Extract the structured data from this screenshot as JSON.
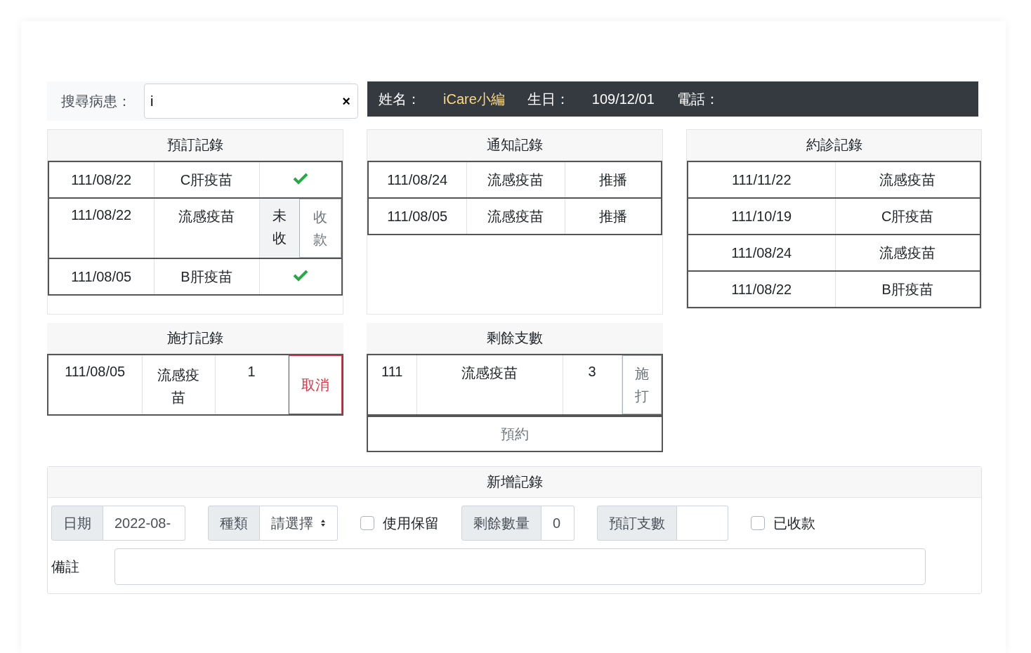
{
  "search": {
    "label": "搜尋病患：",
    "value": "i",
    "clear": "×"
  },
  "patient": {
    "name_label": "姓名：",
    "name": "iCare小編",
    "birthday_label": "生日：",
    "birthday": "109/12/01",
    "phone_label": "電話："
  },
  "bookings": {
    "title": "預訂記錄",
    "rows": [
      {
        "date": "111/08/22",
        "vaccine": "C肝疫苗",
        "paid": true
      },
      {
        "date": "111/08/22",
        "vaccine": "流感疫苗",
        "paid": false,
        "unpaid_text": "未收",
        "collect_button": "收款"
      },
      {
        "date": "111/08/05",
        "vaccine": "B肝疫苗",
        "paid": true
      }
    ]
  },
  "notifications": {
    "title": "通知記錄",
    "rows": [
      {
        "date": "111/08/24",
        "vaccine": "流感疫苗",
        "method": "推播"
      },
      {
        "date": "111/08/05",
        "vaccine": "流感疫苗",
        "method": "推播"
      }
    ]
  },
  "appointments": {
    "title": "約診記錄",
    "rows": [
      {
        "date": "111/11/22",
        "vaccine": "流感疫苗"
      },
      {
        "date": "111/10/19",
        "vaccine": "C肝疫苗"
      },
      {
        "date": "111/08/24",
        "vaccine": "流感疫苗"
      },
      {
        "date": "111/08/22",
        "vaccine": "B肝疫苗"
      }
    ]
  },
  "injections": {
    "title": "施打記錄",
    "rows": [
      {
        "date": "111/08/05",
        "vaccine": "流感疫苗",
        "count": "1",
        "cancel_button": "取消"
      }
    ]
  },
  "remaining": {
    "title": "剩餘支數",
    "rows": [
      {
        "year": "111",
        "vaccine": "流感疫苗",
        "count": "3",
        "inject_button": "施打"
      }
    ],
    "book_button": "預約"
  },
  "new_record": {
    "title": "新增記錄",
    "date": {
      "label": "日期",
      "value": "2022-08-"
    },
    "type": {
      "label": "種類",
      "placeholder": "請選擇"
    },
    "use_reserve": {
      "label": "使用保留",
      "checked": false
    },
    "remaining_qty": {
      "label": "剩餘數量",
      "value": "0"
    },
    "booking_qty": {
      "label": "預訂支數"
    },
    "paid": {
      "label": "已收款",
      "checked": false
    },
    "note": {
      "label": "備註"
    }
  }
}
